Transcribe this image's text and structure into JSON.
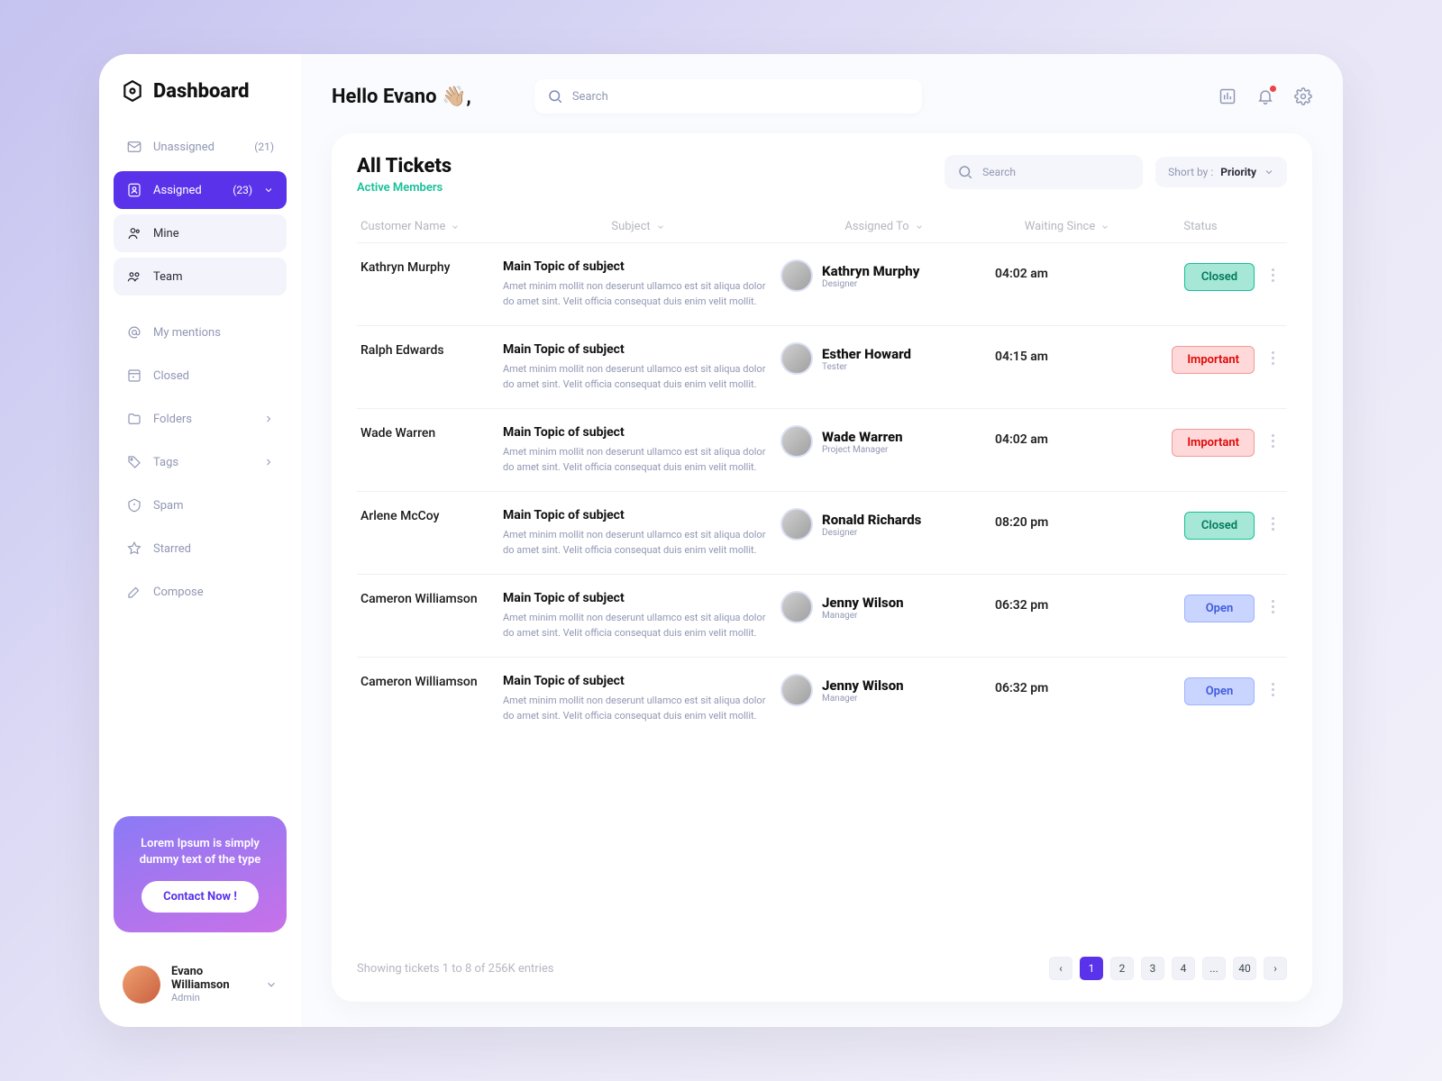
{
  "brand": {
    "title": "Dashboard"
  },
  "sidebar": {
    "items": [
      {
        "label": "Unassigned",
        "count": "(21)"
      },
      {
        "label": "Assigned",
        "count": "(23)"
      },
      {
        "label": "Mine"
      },
      {
        "label": "Team"
      },
      {
        "label": "My mentions"
      },
      {
        "label": "Closed"
      },
      {
        "label": "Folders"
      },
      {
        "label": "Tags"
      },
      {
        "label": "Spam"
      },
      {
        "label": "Starred"
      },
      {
        "label": "Compose"
      }
    ],
    "promo": {
      "text": "Lorem Ipsum is simply dummy text of the type",
      "button": "Contact Now !"
    },
    "user": {
      "name": "Evano Williamson",
      "role": "Admin"
    }
  },
  "topbar": {
    "greeting": "Hello Evano 👋🏼,",
    "search_placeholder": "Search"
  },
  "panel": {
    "title": "All Tickets",
    "subtitle": "Active Members",
    "search_placeholder": "Search",
    "sort_prefix": "Short by : ",
    "sort_value": "Priority",
    "columns": [
      "Customer Name",
      "Subject",
      "Assigned To",
      "Waiting Since",
      "Status"
    ],
    "subject_heading": "Main Topic of subject",
    "subject_body": "Amet minim mollit non deserunt ullamco est sit aliqua dolor do amet sint. Velit officia consequat duis enim velit mollit.",
    "rows": [
      {
        "customer": "Kathryn Murphy",
        "assignee": "Kathryn Murphy",
        "role": "Designer",
        "time": "04:02 am",
        "status": "Closed",
        "status_class": "closed"
      },
      {
        "customer": "Ralph Edwards",
        "assignee": "Esther Howard",
        "role": "Tester",
        "time": "04:15 am",
        "status": "Important",
        "status_class": "important"
      },
      {
        "customer": "Wade Warren",
        "assignee": "Wade Warren",
        "role": "Project Manager",
        "time": "04:02 am",
        "status": "Important",
        "status_class": "important"
      },
      {
        "customer": "Arlene McCoy",
        "assignee": "Ronald Richards",
        "role": "Designer",
        "time": "08:20 pm",
        "status": "Closed",
        "status_class": "closed"
      },
      {
        "customer": "Cameron Williamson",
        "assignee": "Jenny Wilson",
        "role": "Manager",
        "time": "06:32 pm",
        "status": "Open",
        "status_class": "open"
      },
      {
        "customer": "Cameron Williamson",
        "assignee": "Jenny Wilson",
        "role": "Manager",
        "time": "06:32 pm",
        "status": "Open",
        "status_class": "open"
      }
    ],
    "pager": {
      "info": "Showing tickets 1 to 8 of  256K entries",
      "pages": [
        "1",
        "2",
        "3",
        "4",
        "...",
        "40"
      ]
    }
  }
}
